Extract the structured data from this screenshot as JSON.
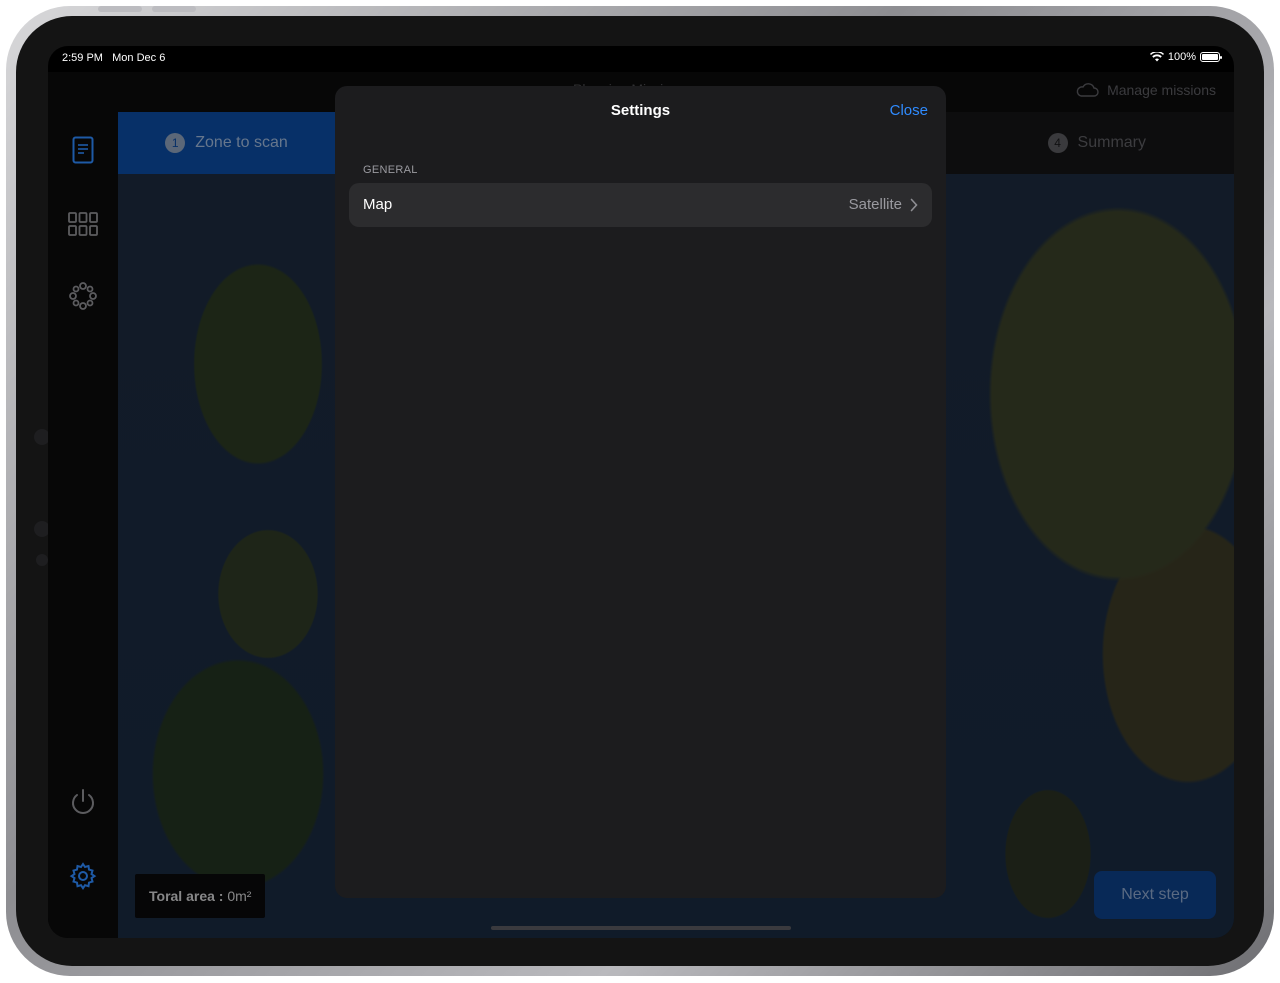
{
  "status": {
    "time": "2:59 PM",
    "date": "Mon Dec 6",
    "battery": "100%"
  },
  "topbar": {
    "title": "Planning Mission",
    "manage_label": "Manage missions"
  },
  "steps": {
    "active": {
      "number": "1",
      "label": "Zone to scan"
    },
    "last": {
      "number": "4",
      "label": "Summary"
    }
  },
  "footer": {
    "total_label": "Toral area :",
    "total_value": "0m²",
    "next_label": "Next step"
  },
  "modal": {
    "title": "Settings",
    "close_label": "Close",
    "section": "GENERAL",
    "rows": [
      {
        "label": "Map",
        "value": "Satellite"
      }
    ]
  },
  "colors": {
    "accent": "#2f8bff",
    "step_active": "#0b4aa0",
    "modal_bg": "#1c1c1e",
    "row_bg": "#2c2c2e"
  }
}
